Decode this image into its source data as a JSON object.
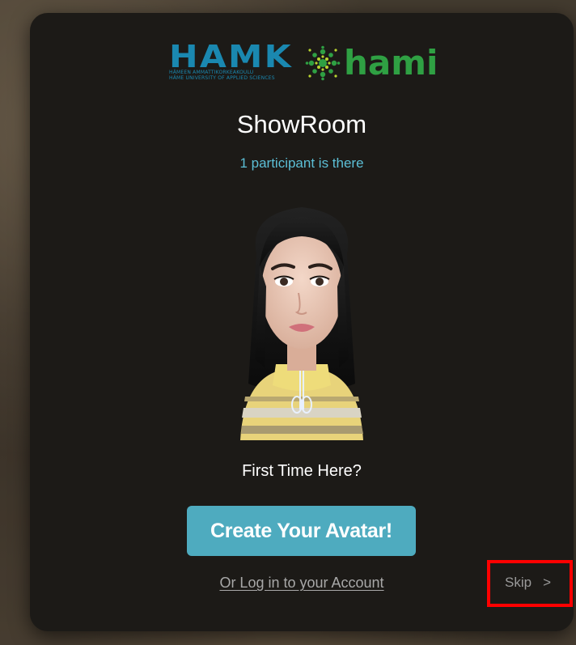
{
  "logos": {
    "hamk_word": "HAMK",
    "hamk_sub_line1": "HÄMEEN AMMATTIKORKEAKOULU",
    "hamk_sub_line2": "HÄME UNIVERSITY OF APPLIED SCIENCES",
    "hami_word": "hami",
    "hamk_color": "#1a88b0",
    "hami_color": "#2fa043"
  },
  "room": {
    "title": "ShowRoom",
    "participants": "1 participant is there"
  },
  "avatar": {
    "icon": "avatar-preview"
  },
  "onboarding": {
    "prompt": "First Time Here?",
    "create_button": "Create Your Avatar!",
    "login_link": "Or Log in to your Account",
    "skip_label": "Skip",
    "skip_chevron": ">"
  },
  "colors": {
    "accent": "#4eabbf",
    "participants_text": "#5cbfd6",
    "panel": "#1c1a17",
    "highlight_box": "#ff0000"
  }
}
